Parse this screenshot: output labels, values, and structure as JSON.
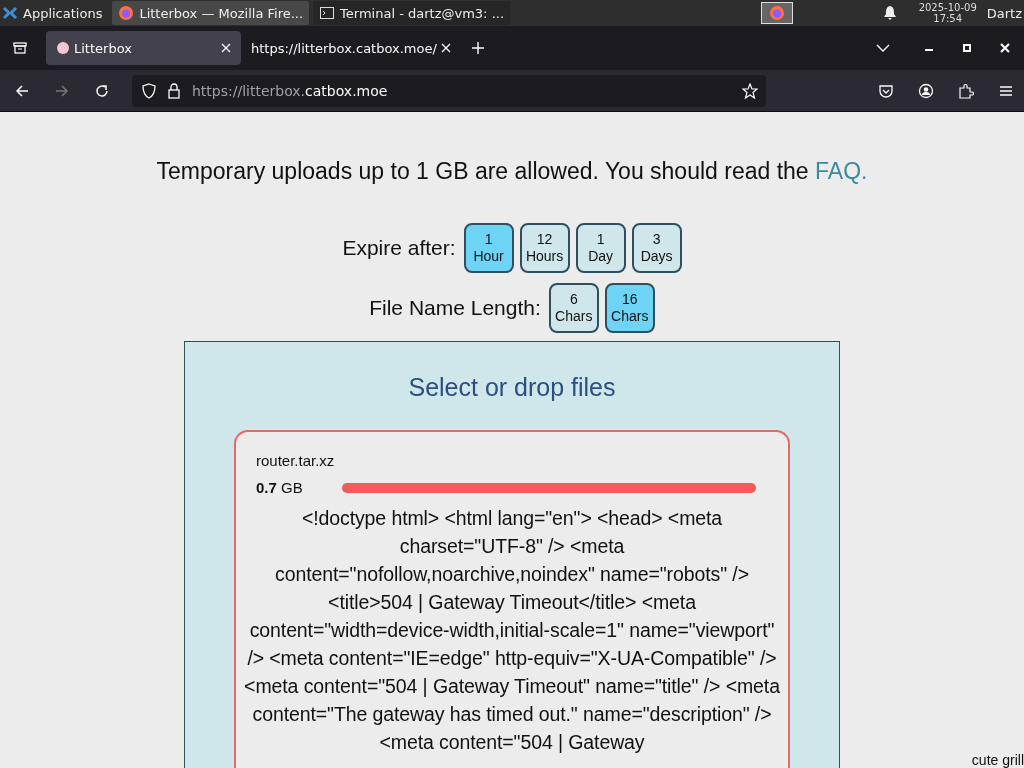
{
  "taskbar": {
    "apps_label": "Applications",
    "windows": [
      {
        "kind": "firefox",
        "title": "Litterbox — Mozilla Fire...",
        "selected": true
      },
      {
        "kind": "terminal",
        "title": "Terminal - dartz@vm3: ...",
        "selected": false
      }
    ],
    "date": "2025-10-09",
    "time": "17:54",
    "user": "Dartz"
  },
  "tabs": [
    {
      "title": "Litterbox",
      "selected": true
    },
    {
      "title": "https://litterbox.catbox.moe/",
      "selected": false
    }
  ],
  "address": {
    "dim": "https://litterbox.",
    "domain": "catbox.moe"
  },
  "page": {
    "intro": "Temporary uploads up to 1 GB are allowed. You should read the ",
    "faq_link": "FAQ.",
    "expire_label": "Expire after:",
    "expire_options": [
      {
        "num": "1",
        "unit": "Hour",
        "selected": true
      },
      {
        "num": "12",
        "unit": "Hours",
        "selected": false
      },
      {
        "num": "1",
        "unit": "Day",
        "selected": false
      },
      {
        "num": "3",
        "unit": "Days",
        "selected": false
      }
    ],
    "length_label": "File Name Length:",
    "length_options": [
      {
        "num": "6",
        "unit": "Chars",
        "selected": false
      },
      {
        "num": "16",
        "unit": "Chars",
        "selected": true
      }
    ],
    "drop_title": "Select or drop files",
    "file": {
      "name": "router.tar.xz",
      "size": "**0.7** GB",
      "level": 1,
      "error": true,
      "response": "<!doctype html> <html lang=\"en\"> <head> <meta charset=\"UTF-8\" /> <meta content=\"nofollow,noarchive,noindex\" name=\"robots\" /> <title>504 | Gateway Timeout</title> <meta content=\"width=device-width,initial-scale=1\" name=\"viewport\" /> <meta content=\"IE=edge\" http-equiv=\"X-UA-Compatible\" /> <meta content=\"504 | Gateway Timeout\" name=\"title\" /> <meta content=\"The gateway has timed out.\" name=\"description\" /> <meta content=\"504 | Gateway"
    },
    "corner_text": "cute grill"
  }
}
